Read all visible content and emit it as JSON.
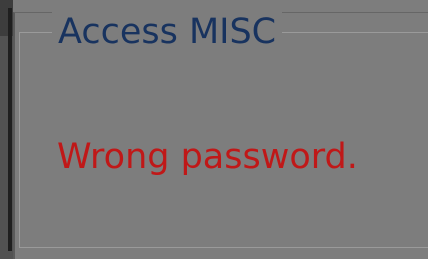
{
  "dialog": {
    "group_title": "Access MISC",
    "message": "Wrong password."
  },
  "colors": {
    "background": "#7d7d7d",
    "title": "#18335f",
    "message": "#c01818",
    "frame": "#9a9a9a"
  }
}
